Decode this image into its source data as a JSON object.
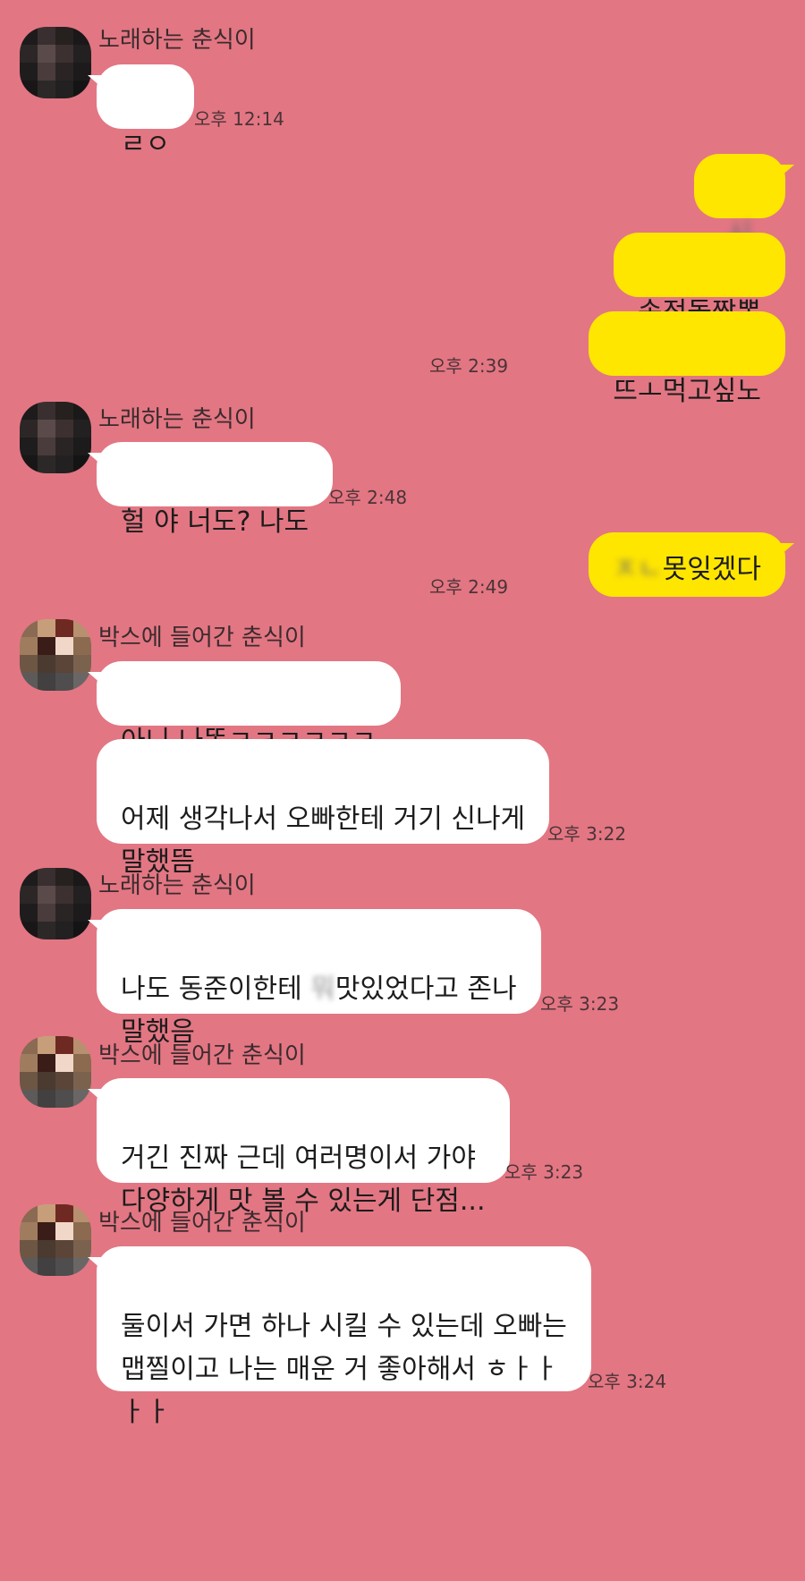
{
  "messages": [
    {
      "sender": "노래하는 춘식이",
      "text": "ㄹㅇ",
      "time": "오후 12:14"
    },
    {
      "text": "시바",
      "blurred": true
    },
    {
      "text": "송정돌짬뽕"
    },
    {
      "text": "뜨ㅗ먹고싶노",
      "time": "오후 2:39"
    },
    {
      "sender": "노래하는 춘식이",
      "text": "헐 야 너도? 나도",
      "time": "오후 2:48"
    },
    {
      "prefix": "ㅈㄴ",
      "text": "못잊겠다",
      "time": "오후 2:49"
    },
    {
      "sender": "박스에 들어간 춘식이",
      "text": "아니 나똒ㅋㅋㅋㅋㅋㅋ"
    },
    {
      "text": "어제 생각나서 오빠한테 거기 신나게\n말했뜸",
      "time": "오후 3:22"
    },
    {
      "sender": "노래하는 춘식이",
      "text_a": "나도 동준이한테 ",
      "censored": "뭐",
      "text_b": "맛있었다고 존나\n말했음",
      "time": "오후 3:23"
    },
    {
      "sender": "박스에 들어간 춘식이",
      "text": "거긴 진짜 근데 여러명이서 가야\n다양하게 맛 볼 수 있는게 단점...",
      "time": "오후 3:23"
    },
    {
      "sender": "박스에 들어간 춘식이",
      "text": "둘이서 가면 하나 시킬 수 있는데 오빠는\n맵찔이고 나는 매운 거 좋아해서 ㅎㅏㅏ\nㅏㅏ",
      "time": "오후 3:24"
    }
  ],
  "colors": {
    "background": "#e37683",
    "incoming_bubble": "#ffffff",
    "outgoing_bubble": "#ffe600"
  }
}
